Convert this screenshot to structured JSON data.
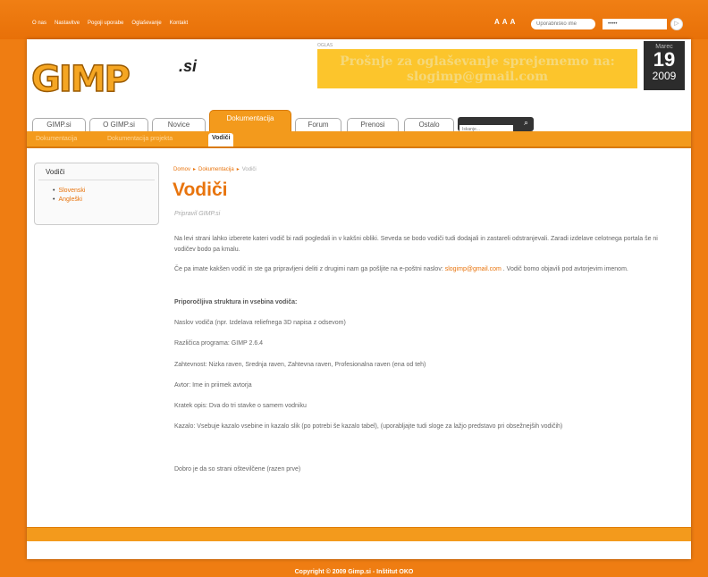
{
  "topnav": [
    "O nas",
    "Nastavitve",
    "Pogoji uporabe",
    "Oglaševanje",
    "Kontakt"
  ],
  "fontsize_icons": [
    "A",
    "A",
    "A"
  ],
  "login": {
    "username_placeholder": "Uporabniško ime",
    "password_value": "•••••",
    "submit_label": "▷"
  },
  "ad": {
    "label": "OGLAS",
    "text_line1": "Prošnje za oglaševanje sprejememo na:",
    "text_line2": "slogimp@gmail.com"
  },
  "date": {
    "month": "Marec",
    "day": "19",
    "year": "2009"
  },
  "logo": {
    "text": "GIMP",
    "suffix": ".si"
  },
  "tabs": [
    "GIMP.si",
    "O GIMP.si",
    "Novice",
    "Dokumentacija",
    "Forum",
    "Prenosi",
    "Ostalo"
  ],
  "search": {
    "placeholder": "Iskanje..."
  },
  "subnav": [
    "Dokumentacija",
    "Dokumentacija projekta",
    "Vodiči"
  ],
  "sidebar": {
    "title": "Vodiči",
    "items": [
      "Slovenski",
      "Angleški"
    ]
  },
  "breadcrumb": [
    "Domov",
    "Dokumentacija",
    "Vodiči"
  ],
  "content": {
    "title": "Vodiči",
    "author": "Pripravil GIMP.si",
    "p1": "Na levi strani lahko izberete kateri vodič bi radi pogledali in v kakšni obliki. Seveda se bodo vodiči tudi dodajali in zastareli odstranjevali. Zaradi izdelave celotnega portala še ni vodičev bodo pa kmalu.",
    "p2_pre": "Če pa imate kakšen vodič in ste ga pripravljeni deliti z drugimi nam ga pošljite na e-poštni naslov: ",
    "p2_link": "slogimp@gmail.com",
    "p2_post": " . Vodič bomo objavili pod avtorjevim imenom.",
    "p3": "Priporočljiva struktura in vsebina vodiča:",
    "p4": "Naslov vodiča (npr. Izdelava reliefnega 3D napisa z odsevom)",
    "p5": "Različica programa: GIMP 2.6.4",
    "p6": "Zahtevnost: Nizka raven, Srednja raven, Zahtevna raven, Profesionalna raven (ena od teh)",
    "p7": "Avtor: Ime in priimek avtorja",
    "p8": "Kratek opis: Dva do tri stavke o samem vodniku",
    "p9": "Kazalo: Vsebuje kazalo vsebine in kazalo slik (po potrebi še kazalo tabel), (uporabljajte tudi sloge za lažjo predstavo pri obsežnejših vodičih)",
    "p10": "Dobro je da so strani oštevilčene (razen prve)"
  },
  "footer": {
    "copyright": "Copyright © 2009 Gimp.si - Inštitut OKO"
  }
}
